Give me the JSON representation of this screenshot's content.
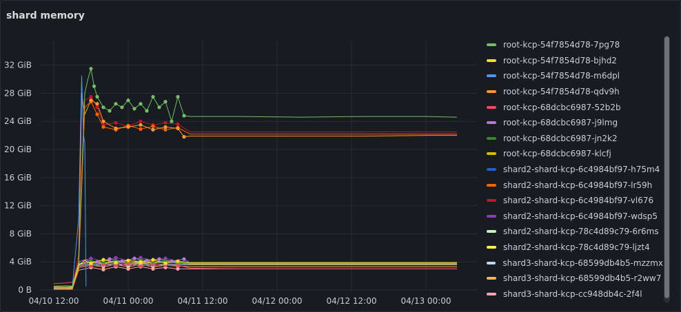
{
  "panel": {
    "title": "shard memory"
  },
  "chart_data": {
    "type": "line",
    "title": "shard memory",
    "xlabel": "",
    "ylabel": "",
    "x_ticks": [
      "04/10 12:00",
      "04/11 00:00",
      "04/11 12:00",
      "04/12 00:00",
      "04/12 12:00",
      "04/13 00:00"
    ],
    "y_ticks": [
      "0 B",
      "4 GiB",
      "8 GiB",
      "12 GiB",
      "16 GiB",
      "20 GiB",
      "24 GiB",
      "28 GiB",
      "32 GiB"
    ],
    "x_unit": "hours since 04/10 12:00",
    "xlim": [
      0,
      70
    ],
    "ylim": [
      0,
      35
    ],
    "y_unit": "GiB",
    "grid": true,
    "legend_position": "right",
    "series": [
      {
        "name": "root-kcp-54f7854d78-7pg78",
        "color": "#73bf69",
        "values": [
          [
            0,
            0.5
          ],
          [
            2,
            0.6
          ],
          [
            3,
            0.5
          ],
          [
            4,
            4
          ],
          [
            5,
            28
          ],
          [
            5.5,
            30
          ],
          [
            6,
            31.5
          ],
          [
            6.5,
            29
          ],
          [
            7,
            27.5
          ],
          [
            8,
            26
          ],
          [
            9,
            25.5
          ],
          [
            10,
            26.5
          ],
          [
            11,
            26
          ],
          [
            12,
            27
          ],
          [
            13,
            25.8
          ],
          [
            14,
            26.5
          ],
          [
            15,
            25.5
          ],
          [
            16,
            27.5
          ],
          [
            17,
            26
          ],
          [
            18,
            26.8
          ],
          [
            19,
            24
          ],
          [
            20,
            27.5
          ],
          [
            21,
            24.8
          ],
          [
            22,
            24.7
          ],
          [
            30,
            24.7
          ],
          [
            40,
            24.6
          ],
          [
            50,
            24.7
          ],
          [
            60,
            24.7
          ],
          [
            65,
            24.6
          ]
        ]
      },
      {
        "name": "root-kcp-54f7854d78-bjhd2",
        "color": "#fade2a",
        "values": [
          [
            0,
            0.4
          ],
          [
            3,
            0.4
          ],
          [
            4,
            3.5
          ],
          [
            5,
            4.2
          ],
          [
            6,
            3.8
          ],
          [
            8,
            4.3
          ],
          [
            10,
            3.9
          ],
          [
            12,
            4.2
          ],
          [
            14,
            4
          ],
          [
            16,
            4.3
          ],
          [
            18,
            3.8
          ],
          [
            20,
            4.1
          ],
          [
            22,
            3.9
          ],
          [
            30,
            3.9
          ],
          [
            40,
            3.9
          ],
          [
            50,
            3.9
          ],
          [
            60,
            3.9
          ],
          [
            65,
            3.9
          ]
        ]
      },
      {
        "name": "root-kcp-54f7854d78-m6dpl",
        "color": "#5794f2",
        "values": [
          [
            0,
            0.3
          ],
          [
            2,
            0.3
          ],
          [
            3,
            0.5
          ],
          [
            4,
            10
          ],
          [
            4.5,
            30.5
          ],
          [
            4.8,
            22
          ],
          [
            5,
            21
          ],
          [
            5.2,
            0.5
          ]
        ]
      },
      {
        "name": "root-kcp-54f7854d78-qdv9h",
        "color": "#ff9830",
        "values": [
          [
            0,
            0.2
          ],
          [
            3,
            0.2
          ],
          [
            4,
            3
          ],
          [
            4.5,
            28
          ],
          [
            5,
            25
          ],
          [
            6,
            27
          ],
          [
            7,
            26.5
          ],
          [
            8,
            24
          ],
          [
            10,
            23
          ],
          [
            12,
            23.2
          ],
          [
            14,
            23.5
          ],
          [
            16,
            22.8
          ],
          [
            18,
            23.2
          ],
          [
            20,
            23
          ],
          [
            21,
            21.8
          ],
          [
            22,
            21.9
          ],
          [
            30,
            21.9
          ],
          [
            40,
            21.9
          ],
          [
            50,
            21.9
          ],
          [
            60,
            22
          ],
          [
            65,
            22
          ]
        ]
      },
      {
        "name": "root-kcp-68dcbc6987-52b2b",
        "color": "#f2495c",
        "values": [
          [
            0,
            0.9
          ],
          [
            2,
            1
          ],
          [
            3,
            1.1
          ],
          [
            4,
            3
          ],
          [
            5,
            4
          ],
          [
            6,
            3.4
          ],
          [
            8,
            3.6
          ],
          [
            10,
            3.5
          ],
          [
            12,
            3.7
          ],
          [
            14,
            3.4
          ],
          [
            16,
            3.6
          ],
          [
            18,
            3.5
          ],
          [
            20,
            3.5
          ],
          [
            22,
            3.1
          ],
          [
            30,
            3
          ],
          [
            40,
            3
          ],
          [
            50,
            3
          ],
          [
            60,
            3
          ],
          [
            65,
            3
          ]
        ]
      },
      {
        "name": "root-kcp-68dcbc6987-j9lmg",
        "color": "#b877d9",
        "values": [
          [
            0,
            0.3
          ],
          [
            3,
            0.3
          ],
          [
            4,
            4
          ],
          [
            5,
            4.3
          ],
          [
            7,
            4
          ],
          [
            9,
            4.4
          ],
          [
            11,
            4.1
          ],
          [
            13,
            4.5
          ],
          [
            15,
            4.2
          ],
          [
            17,
            4.4
          ],
          [
            19,
            4.1
          ],
          [
            21,
            4.4
          ],
          [
            22,
            3.8
          ],
          [
            30,
            3.8
          ],
          [
            40,
            3.8
          ],
          [
            50,
            3.8
          ],
          [
            60,
            3.8
          ],
          [
            65,
            3.8
          ]
        ]
      },
      {
        "name": "root-kcp-68dcbc6987-jn2k2",
        "color": "#37872d",
        "values": [
          [
            0,
            0.2
          ],
          [
            3,
            0.2
          ],
          [
            4,
            3.8
          ],
          [
            6,
            4.1
          ],
          [
            8,
            3.9
          ],
          [
            10,
            4.2
          ],
          [
            12,
            4
          ],
          [
            14,
            4.3
          ],
          [
            16,
            4
          ],
          [
            18,
            4.2
          ],
          [
            20,
            4
          ],
          [
            22,
            3.8
          ],
          [
            30,
            3.8
          ],
          [
            40,
            3.8
          ],
          [
            50,
            3.8
          ],
          [
            60,
            3.8
          ],
          [
            65,
            3.8
          ]
        ]
      },
      {
        "name": "root-kcp-68dcbc6987-klcfj",
        "color": "#e0b400",
        "values": [
          [
            0,
            0.1
          ],
          [
            3,
            0.1
          ],
          [
            4,
            3.6
          ],
          [
            6,
            4
          ],
          [
            8,
            3.7
          ],
          [
            10,
            4.1
          ],
          [
            12,
            3.8
          ],
          [
            14,
            4
          ],
          [
            16,
            3.8
          ],
          [
            18,
            4.1
          ],
          [
            20,
            3.9
          ],
          [
            22,
            3.7
          ],
          [
            30,
            3.7
          ],
          [
            40,
            3.7
          ],
          [
            50,
            3.7
          ],
          [
            60,
            3.7
          ],
          [
            65,
            3.7
          ]
        ]
      },
      {
        "name": "shard2-shard-kcp-6c4984bf97-h75m4",
        "color": "#1f60c4",
        "values": [
          [
            0,
            0.2
          ],
          [
            3,
            0.2
          ],
          [
            4,
            3.5
          ],
          [
            6,
            3.9
          ],
          [
            8,
            3.6
          ],
          [
            10,
            4
          ],
          [
            12,
            3.7
          ],
          [
            14,
            4
          ],
          [
            16,
            3.7
          ],
          [
            18,
            4
          ],
          [
            20,
            3.8
          ],
          [
            22,
            3.7
          ],
          [
            30,
            3.7
          ],
          [
            40,
            3.7
          ],
          [
            50,
            3.7
          ],
          [
            60,
            3.7
          ],
          [
            65,
            3.7
          ]
        ]
      },
      {
        "name": "shard2-shard-kcp-6c4984bf97-lr59h",
        "color": "#fa6400",
        "values": [
          [
            0,
            0.1
          ],
          [
            3,
            0.1
          ],
          [
            4,
            3
          ],
          [
            5,
            26
          ],
          [
            6,
            26.8
          ],
          [
            7,
            25
          ],
          [
            8,
            23.2
          ],
          [
            10,
            22.8
          ],
          [
            12,
            23.4
          ],
          [
            14,
            22.9
          ],
          [
            16,
            23.3
          ],
          [
            18,
            22.8
          ],
          [
            20,
            23.1
          ],
          [
            22,
            22.2
          ],
          [
            30,
            22.2
          ],
          [
            40,
            22.2
          ],
          [
            50,
            22.2
          ],
          [
            60,
            22.2
          ],
          [
            65,
            22.2
          ]
        ]
      },
      {
        "name": "shard2-shard-kcp-6c4984bf97-vl676",
        "color": "#c4162a",
        "values": [
          [
            0,
            0.6
          ],
          [
            3,
            0.6
          ],
          [
            4,
            5
          ],
          [
            5,
            27
          ],
          [
            6,
            27.5
          ],
          [
            7,
            26
          ],
          [
            8,
            23.5
          ],
          [
            10,
            23.8
          ],
          [
            12,
            23.3
          ],
          [
            14,
            24
          ],
          [
            16,
            23.5
          ],
          [
            18,
            23.8
          ],
          [
            20,
            23.6
          ],
          [
            22,
            22.5
          ],
          [
            30,
            22.5
          ],
          [
            40,
            22.5
          ],
          [
            50,
            22.5
          ],
          [
            60,
            22.5
          ],
          [
            65,
            22.5
          ]
        ]
      },
      {
        "name": "shard2-shard-kcp-6c4984bf97-wdsp5",
        "color": "#8f3bb8",
        "values": [
          [
            0,
            0.2
          ],
          [
            3,
            0.2
          ],
          [
            4,
            4
          ],
          [
            6,
            4.5
          ],
          [
            8,
            4.1
          ],
          [
            10,
            4.6
          ],
          [
            12,
            4.2
          ],
          [
            14,
            4.6
          ],
          [
            16,
            4.2
          ],
          [
            18,
            4.5
          ],
          [
            20,
            4.1
          ],
          [
            22,
            3.9
          ],
          [
            30,
            3.9
          ],
          [
            40,
            3.9
          ],
          [
            50,
            3.9
          ],
          [
            60,
            3.9
          ],
          [
            65,
            3.9
          ]
        ]
      },
      {
        "name": "shard2-shard-kcp-78c4d89c79-6r6ms",
        "color": "#c8f2c2",
        "values": [
          [
            0,
            0.3
          ],
          [
            3,
            0.3
          ],
          [
            4,
            3.7
          ],
          [
            6,
            4
          ],
          [
            8,
            3.8
          ],
          [
            10,
            4.1
          ],
          [
            12,
            3.8
          ],
          [
            14,
            4.1
          ],
          [
            16,
            3.9
          ],
          [
            18,
            4
          ],
          [
            20,
            3.9
          ],
          [
            22,
            3.8
          ],
          [
            30,
            3.8
          ],
          [
            40,
            3.8
          ],
          [
            50,
            3.8
          ],
          [
            60,
            3.8
          ],
          [
            65,
            3.8
          ]
        ]
      },
      {
        "name": "shard2-shard-kcp-78c4d89c79-ljzt4",
        "color": "#ffee52",
        "values": [
          [
            0,
            0.2
          ],
          [
            3,
            0.2
          ],
          [
            4,
            3.6
          ],
          [
            6,
            3.9
          ],
          [
            8,
            3.7
          ],
          [
            10,
            4
          ],
          [
            12,
            3.7
          ],
          [
            14,
            3.9
          ],
          [
            16,
            3.7
          ],
          [
            18,
            4
          ],
          [
            20,
            3.8
          ],
          [
            22,
            3.7
          ],
          [
            30,
            3.7
          ],
          [
            40,
            3.7
          ],
          [
            50,
            3.7
          ],
          [
            60,
            3.7
          ],
          [
            65,
            3.7
          ]
        ]
      },
      {
        "name": "shard3-shard-kcp-68599db4b5-mzzmx",
        "color": "#c0d8ff",
        "values": [
          [
            0,
            0.3
          ],
          [
            3,
            0.3
          ],
          [
            4,
            3.4
          ],
          [
            6,
            3.7
          ],
          [
            8,
            3.5
          ],
          [
            10,
            3.8
          ],
          [
            12,
            3.5
          ],
          [
            14,
            3.8
          ],
          [
            16,
            3.5
          ],
          [
            18,
            3.7
          ],
          [
            20,
            3.6
          ],
          [
            22,
            3.6
          ],
          [
            30,
            3.6
          ],
          [
            40,
            3.6
          ],
          [
            50,
            3.6
          ],
          [
            60,
            3.6
          ],
          [
            65,
            3.6
          ]
        ]
      },
      {
        "name": "shard3-shard-kcp-68599db4b5-r2ww7",
        "color": "#ffb357",
        "values": [
          [
            0,
            0.2
          ],
          [
            3,
            0.2
          ],
          [
            4,
            3.2
          ],
          [
            6,
            3.5
          ],
          [
            8,
            3.3
          ],
          [
            10,
            3.6
          ],
          [
            12,
            3.3
          ],
          [
            14,
            3.6
          ],
          [
            16,
            3.3
          ],
          [
            18,
            3.5
          ],
          [
            20,
            3.4
          ],
          [
            22,
            3.3
          ],
          [
            30,
            3.3
          ],
          [
            40,
            3.3
          ],
          [
            50,
            3.3
          ],
          [
            60,
            3.3
          ],
          [
            65,
            3.3
          ]
        ]
      },
      {
        "name": "shard3-shard-kcp-cc948db4c-2f4l",
        "color": "#ffa6b0",
        "values": [
          [
            0,
            0.2
          ],
          [
            3,
            0.2
          ],
          [
            4,
            2.8
          ],
          [
            6,
            3.2
          ],
          [
            8,
            2.9
          ],
          [
            10,
            3.3
          ],
          [
            12,
            3
          ],
          [
            14,
            3.3
          ],
          [
            16,
            3
          ],
          [
            18,
            3.2
          ],
          [
            20,
            3
          ],
          [
            22,
            3
          ],
          [
            30,
            3
          ],
          [
            40,
            3
          ],
          [
            50,
            3
          ],
          [
            60,
            3
          ],
          [
            65,
            3
          ]
        ]
      }
    ]
  }
}
